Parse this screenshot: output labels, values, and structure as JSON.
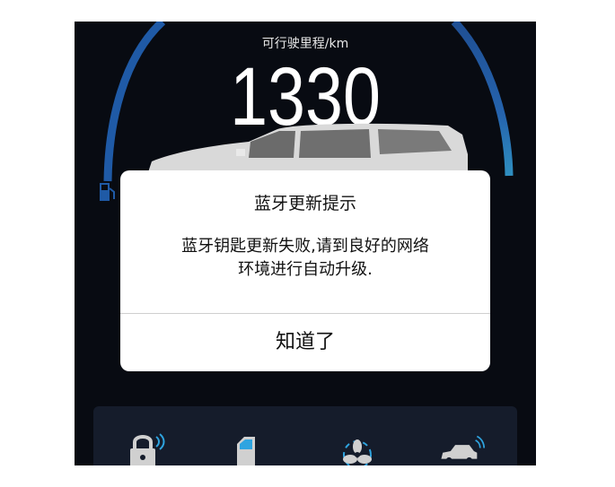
{
  "dashboard": {
    "range_label": "可行驶里程/km",
    "range_value": "1330"
  },
  "dialog": {
    "title": "蓝牙更新提示",
    "message_line1": "蓝牙钥匙更新失败,请到良好的网络",
    "message_line2": "环境进行自动升级.",
    "button_label": "知道了"
  },
  "controls": [
    {
      "icon": "lock-icon"
    },
    {
      "icon": "door-icon"
    },
    {
      "icon": "fan-icon"
    },
    {
      "icon": "car-remote-icon"
    }
  ],
  "colors": {
    "screen_bg": "#080b12",
    "arc_blue": "#1f5aa6",
    "panel_bg": "#151c2b",
    "accent_cyan": "#2ea4e0"
  }
}
